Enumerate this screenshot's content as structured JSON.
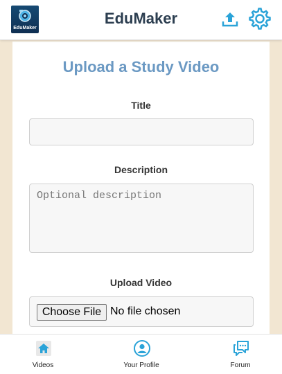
{
  "app": {
    "title": "EduMaker",
    "logo_text": "EduMaker"
  },
  "header": {
    "upload_icon": "upload-icon",
    "settings_icon": "gear-icon"
  },
  "form": {
    "heading": "Upload a Study Video",
    "title_label": "Title",
    "title_value": "",
    "description_label": "Description",
    "description_placeholder": "Optional description",
    "upload_label": "Upload Video",
    "file_button_label": "Choose File",
    "file_status": "No file chosen"
  },
  "nav": {
    "items": [
      {
        "label": "Videos",
        "icon": "home-icon"
      },
      {
        "label": "Your Profile",
        "icon": "user-icon"
      },
      {
        "label": "Forum",
        "icon": "chat-icon"
      }
    ]
  },
  "colors": {
    "accent": "#6b99c3",
    "icon_blue": "#2aa3d8",
    "background": "#f2e6d2"
  }
}
